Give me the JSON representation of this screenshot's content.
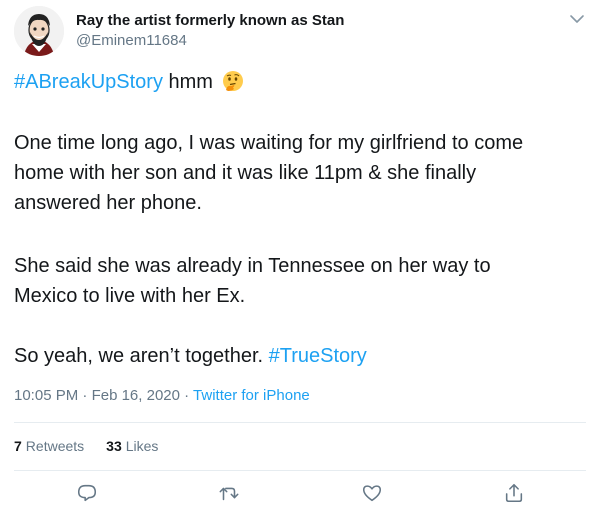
{
  "author": {
    "display_name": "Ray the artist formerly known as Stan",
    "handle": "@Eminem11684"
  },
  "tweet": {
    "hashtag_1": "#ABreakUpStory",
    "line1_rest": " hmm",
    "para1_l1": "One time long ago, I was waiting for my girlfriend to come",
    "para1_l2": "home with her son and it was like 11pm & she finally",
    "para1_l3": "answered her phone.",
    "para2_l1": "She said she was already in Tennessee on her way to",
    "para2_l2": "Mexico to live with her Ex.",
    "para3_text": "So yeah, we aren’t together. ",
    "hashtag_2": "#TrueStory",
    "emoji": "thinking-face-emoji"
  },
  "meta": {
    "time": "10:05 PM",
    "sep1": " · ",
    "date": "Feb 16, 2020",
    "sep2": " · ",
    "source": "Twitter for iPhone"
  },
  "stats": {
    "retweets_count": "7",
    "retweets_label": "Retweets",
    "likes_count": "33",
    "likes_label": "Likes"
  },
  "actions": [
    "reply-icon",
    "retweet-icon",
    "like-icon",
    "share-icon"
  ],
  "colors": {
    "link": "#1da1f2",
    "secondary": "#657786",
    "text": "#14171a",
    "divider": "#e6ecf0"
  }
}
